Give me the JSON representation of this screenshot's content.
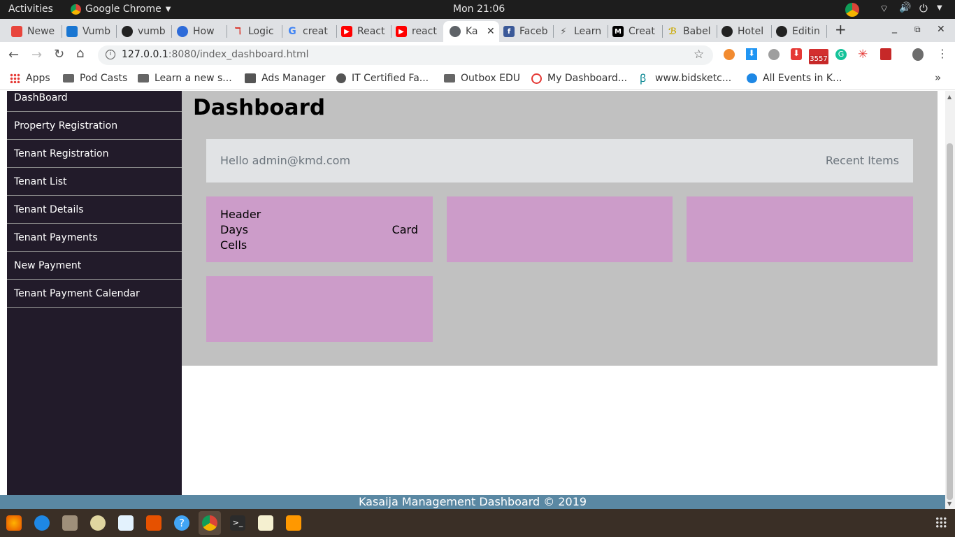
{
  "system": {
    "activities": "Activities",
    "app_menu": "Google Chrome",
    "clock": "Mon 21:06"
  },
  "tabs": [
    {
      "label": "Newe",
      "color": "#e8453c"
    },
    {
      "label": "Vumb",
      "color": "#1976d2"
    },
    {
      "label": "vumb",
      "color": "#222222"
    },
    {
      "label": "How",
      "color": "#2d6bd9"
    },
    {
      "label": "Logic",
      "color": "#d93025"
    },
    {
      "label": "creat",
      "color": "#4285f4"
    },
    {
      "label": "React",
      "color": "#ff0000"
    },
    {
      "label": "react",
      "color": "#ff0000"
    },
    {
      "label": "Ka",
      "color": "#5f6368"
    },
    {
      "label": "Faceb",
      "color": "#3b5998"
    },
    {
      "label": "Learn",
      "color": "#555555"
    },
    {
      "label": "Creat",
      "color": "#000000"
    },
    {
      "label": "Babel",
      "color": "#f5da55"
    },
    {
      "label": "Hotel",
      "color": "#222222"
    },
    {
      "label": "Editin",
      "color": "#222222"
    }
  ],
  "address": {
    "host": "127.0.0.1",
    "path": ":8080/index_dashboard.html"
  },
  "extensions_badge": "3557",
  "bookmarks": [
    "Apps",
    "Pod Casts",
    "Learn a new s...",
    "Ads Manager",
    "IT Certified Fa...",
    "Outbox EDU",
    "My Dashboard...",
    "www.bidsketc...",
    "All Events in K..."
  ],
  "sidebar": {
    "items": [
      "DashBoard",
      "Property Registration",
      "Tenant Registration",
      "Tenant List",
      "Tenant Details",
      "Tenant Payments",
      "New Payment",
      "Tenant Payment Calendar"
    ]
  },
  "main": {
    "title": "Dashboard",
    "greeting": "Hello admin@kmd.com",
    "recent": "Recent Items",
    "card1": {
      "line1": "Header",
      "line2": "Days",
      "line3": "Cells",
      "right": "Card"
    }
  },
  "footer": "Kasaija Management Dashboard © 2019"
}
